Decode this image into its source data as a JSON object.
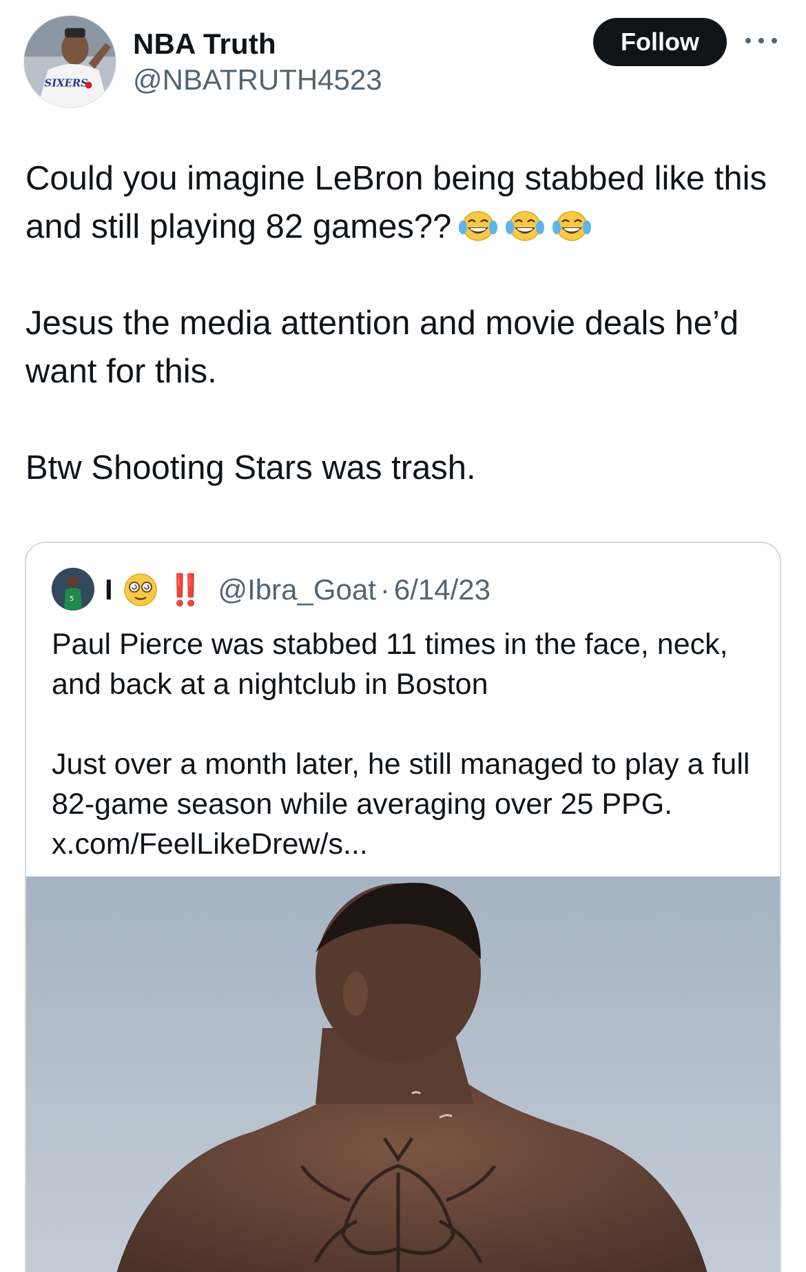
{
  "author": {
    "name": "NBA Truth",
    "handle": "@NBATRUTH4523"
  },
  "actions": {
    "follow_label": "Follow",
    "more_icon": "more-horizontal-icon"
  },
  "tweet": {
    "paragraphs": [
      "Could you imagine LeBron being stabbed like this and still playing 82 games??",
      "Jesus the media attention and movie deals he’d want for this.",
      "Btw Shooting Stars was trash."
    ],
    "emoji_icon": "face-with-tears-of-joy-icon",
    "emoji_count": 3
  },
  "quoted_tweet": {
    "name": "I",
    "face_icon": "face-with-spiral-eyes-icon",
    "bang": "‼️",
    "handle": "@Ibra_Goat",
    "separator": "·",
    "date": "6/14/23",
    "paragraphs": [
      "Paul Pierce was stabbed 11 times in the face, neck, and back at a nightclub in Boston",
      "Just over a month later, he still managed to play a full 82-game season while averaging over 25 PPG.",
      "x.com/FeelLikeDrew/s..."
    ]
  },
  "colors": {
    "text_primary": "#0f1419",
    "text_secondary": "#536471",
    "follow_bg": "#0f1419",
    "card_border": "#cfd9de",
    "bang_red": "#e0242b"
  }
}
